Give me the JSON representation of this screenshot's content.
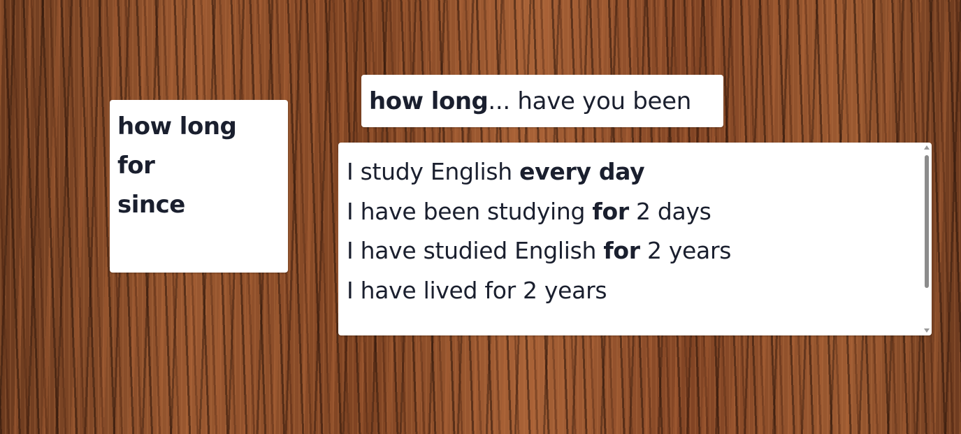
{
  "word_bank": {
    "words": [
      "how long",
      "for",
      "since"
    ]
  },
  "question": {
    "bold": "how long",
    "rest": "... have you been"
  },
  "sentences": [
    {
      "before": "I study English ",
      "highlight": "every day",
      "after": ""
    },
    {
      "before": "I have been studying ",
      "highlight": "for",
      "after": " 2 days"
    },
    {
      "before": "I have studied English ",
      "highlight": "for",
      "after": " 2 years"
    },
    {
      "before": "I have lived for 2 years",
      "highlight": "",
      "after": ""
    }
  ],
  "colors": {
    "text": "#1a1f2e",
    "card": "#ffffff",
    "bark": "#8a4a26"
  }
}
